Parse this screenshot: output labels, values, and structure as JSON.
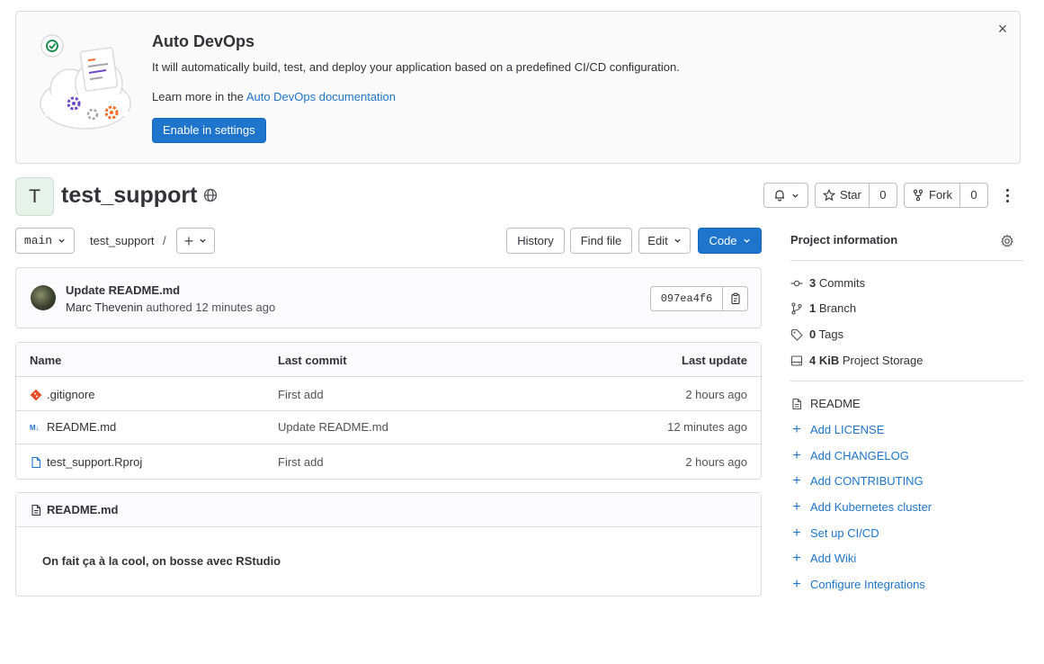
{
  "banner": {
    "title": "Auto DevOps",
    "description": "It will automatically build, test, and deploy your application based on a predefined CI/CD configuration.",
    "learn_prefix": "Learn more in the",
    "learn_link": "Auto DevOps documentation",
    "enable_button": "Enable in settings",
    "close_glyph": "×"
  },
  "project": {
    "avatar_letter": "T",
    "name": "test_support",
    "star_label": "Star",
    "star_count": "0",
    "fork_label": "Fork",
    "fork_count": "0"
  },
  "toolbar": {
    "branch": "main",
    "breadcrumb": "test_support",
    "breadcrumb_sep": "/",
    "add_glyph": "+",
    "history": "History",
    "find_file": "Find file",
    "edit": "Edit",
    "code": "Code"
  },
  "last_commit": {
    "message": "Update README.md",
    "author": "Marc Thevenin",
    "authored_text": "authored 12 minutes ago",
    "sha": "097ea4f6"
  },
  "file_table": {
    "headers": [
      "Name",
      "Last commit",
      "Last update"
    ],
    "rows": [
      {
        "name": ".gitignore",
        "icon": "git-icon",
        "commit": "First add",
        "updated": "2 hours ago"
      },
      {
        "name": "README.md",
        "icon": "markdown-icon",
        "commit": "Update README.md",
        "updated": "12 minutes ago"
      },
      {
        "name": "test_support.Rproj",
        "icon": "file-icon",
        "commit": "First add",
        "updated": "2 hours ago"
      }
    ]
  },
  "readme": {
    "title": "README.md",
    "content": "On fait ça à la cool, on bosse avec RStudio"
  },
  "sidebar": {
    "title": "Project information",
    "stats": [
      {
        "count": "3",
        "label": "Commits",
        "icon": "commit-icon"
      },
      {
        "count": "1",
        "label": "Branch",
        "icon": "branch-icon"
      },
      {
        "count": "0",
        "label": "Tags",
        "icon": "tag-icon"
      },
      {
        "count": "4 KiB",
        "label": "Project Storage",
        "icon": "storage-icon"
      }
    ],
    "readme_label": "README",
    "links": [
      "Add LICENSE",
      "Add CHANGELOG",
      "Add CONTRIBUTING",
      "Add Kubernetes cluster",
      "Set up CI/CD",
      "Add Wiki",
      "Configure Integrations"
    ]
  },
  "colors": {
    "accent": "#1f75cb",
    "border": "#dcdcde",
    "text": "#333238"
  }
}
